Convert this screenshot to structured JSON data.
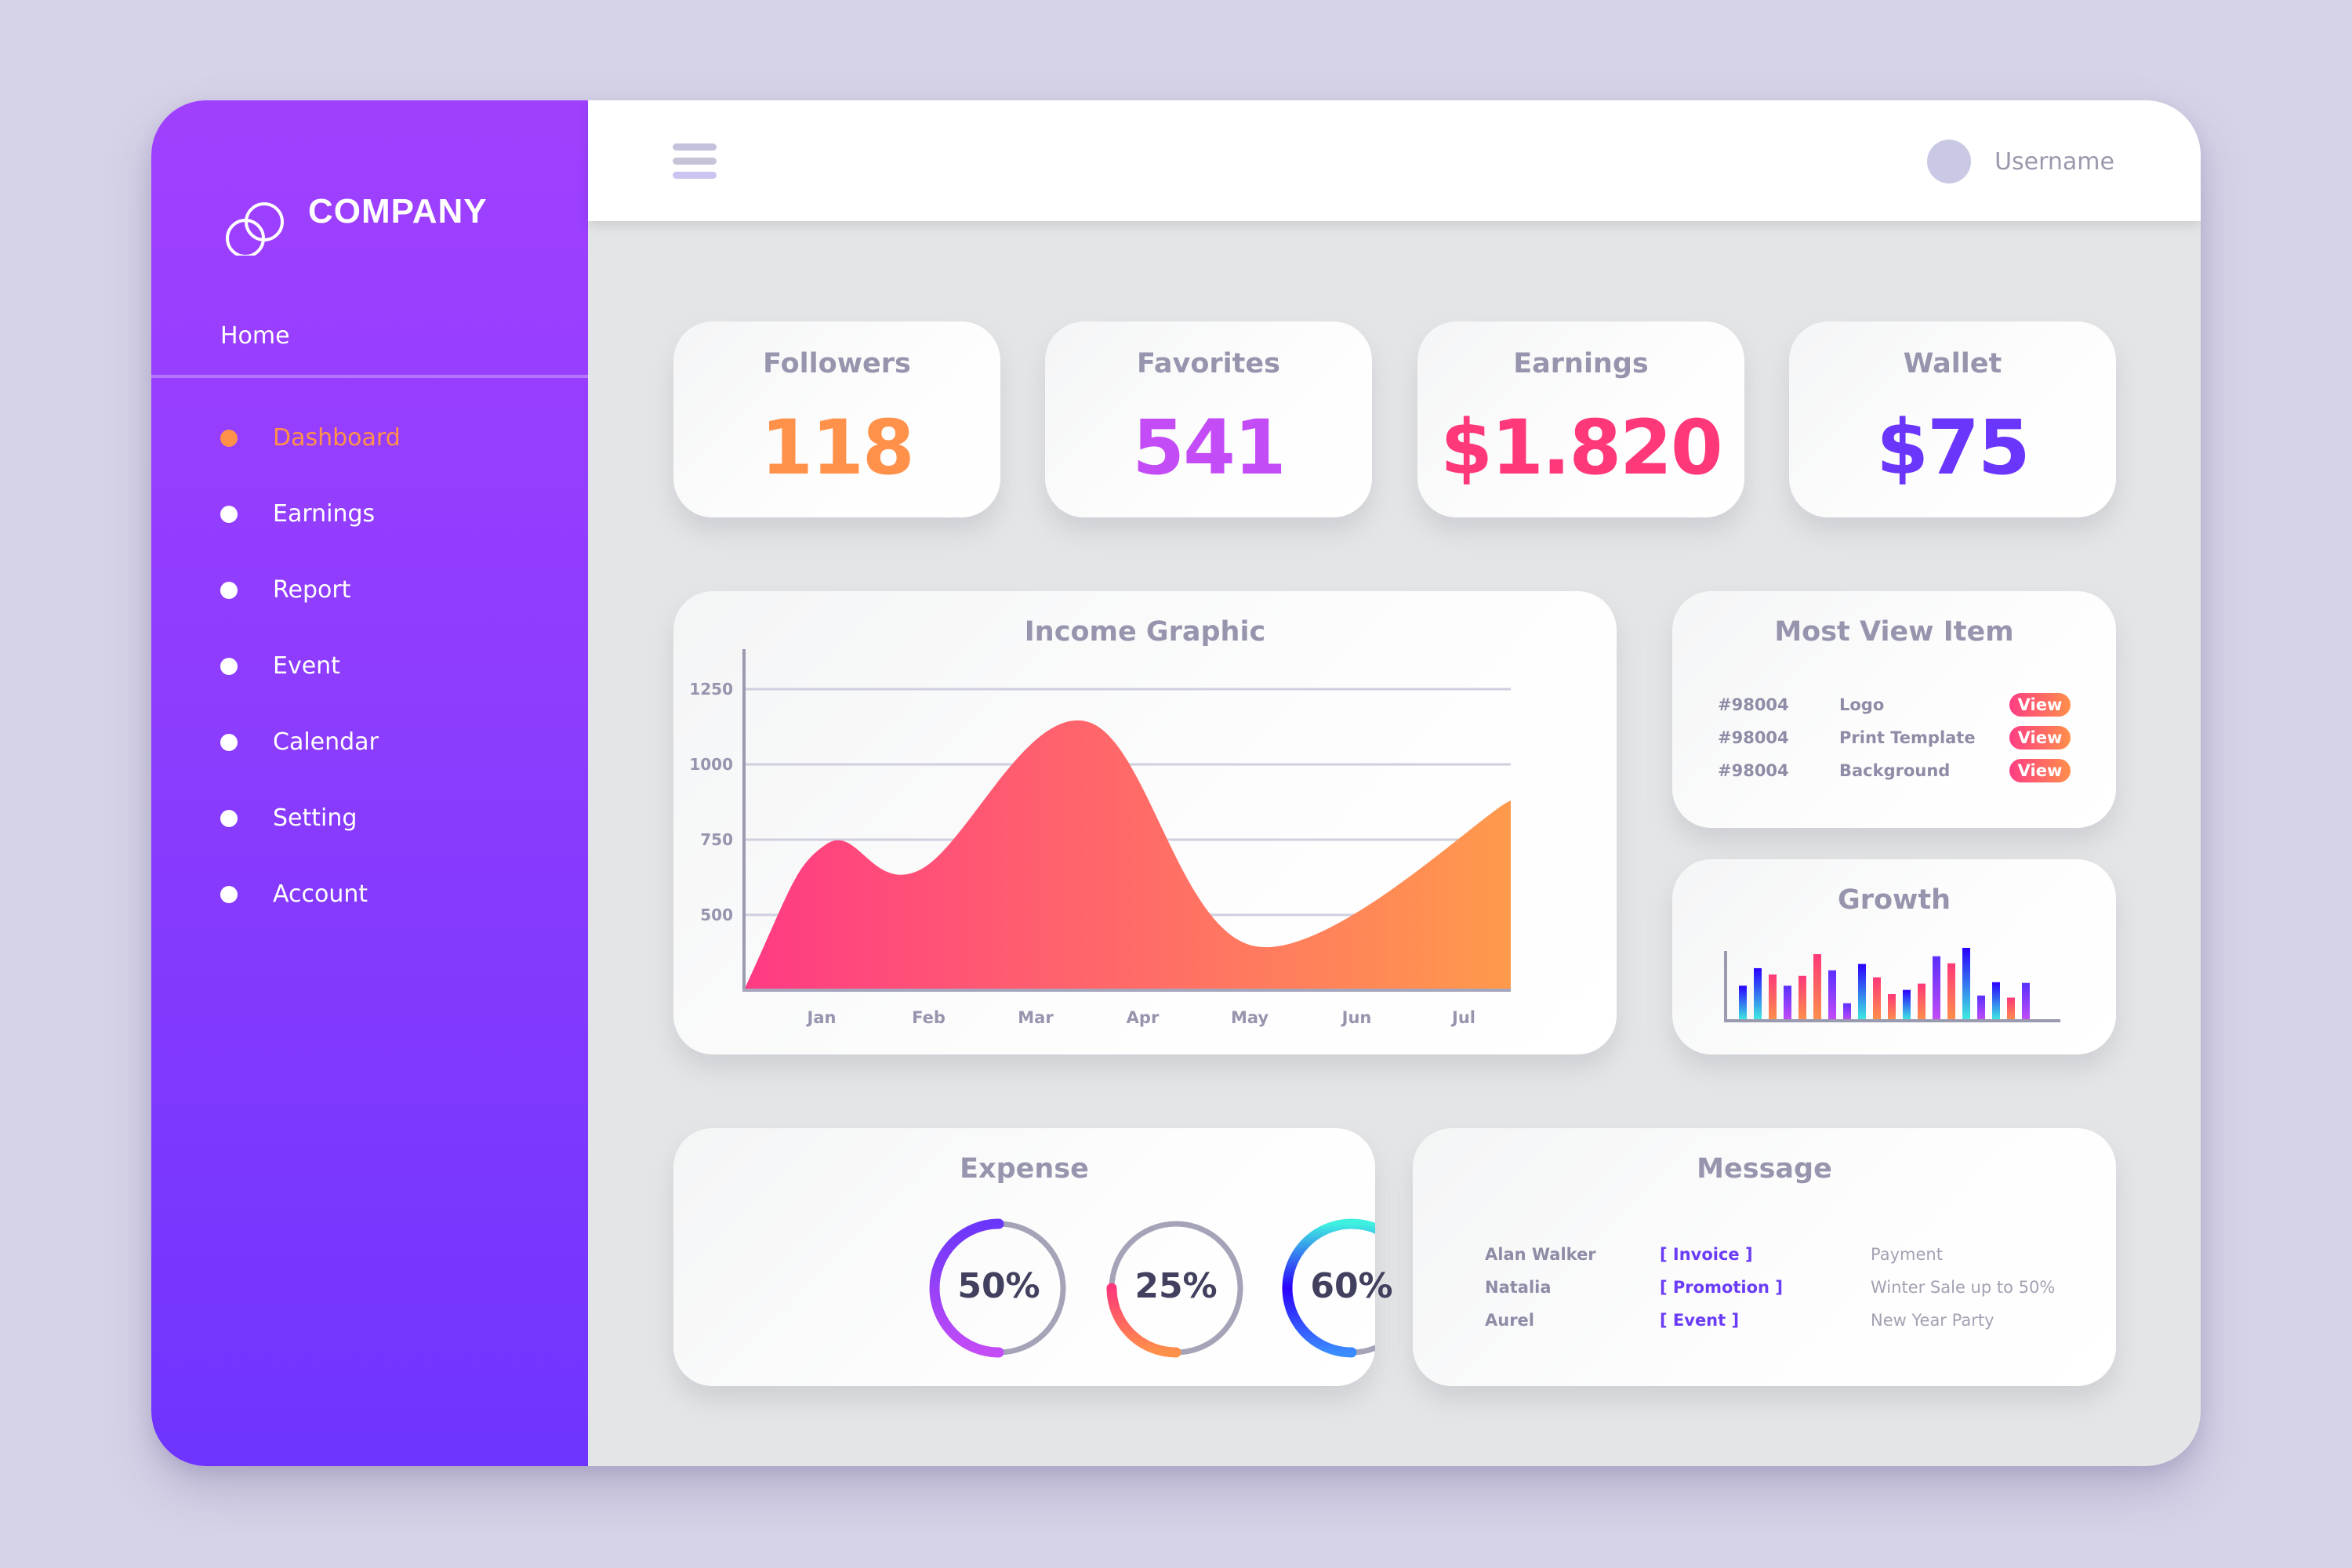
{
  "brand": {
    "name": "COMPANY",
    "logo_icon": "interlocking-rings-icon"
  },
  "sidebar": {
    "home_label": "Home",
    "items": [
      {
        "label": "Dashboard",
        "active": true
      },
      {
        "label": "Earnings",
        "active": false
      },
      {
        "label": "Report",
        "active": false
      },
      {
        "label": "Event",
        "active": false
      },
      {
        "label": "Calendar",
        "active": false
      },
      {
        "label": "Setting",
        "active": false
      },
      {
        "label": "Account",
        "active": false
      }
    ],
    "active_color": "#ff9148"
  },
  "topbar": {
    "menu_icon": "hamburger-menu-icon",
    "username": "Username"
  },
  "stats": [
    {
      "title": "Followers",
      "value": "118",
      "color": "#ff914a"
    },
    {
      "title": "Favorites",
      "value": "541",
      "color": "#c44cf6"
    },
    {
      "title": "Earnings",
      "value": "$1.820",
      "color": "#ff3879"
    },
    {
      "title": "Wallet",
      "value": "$75",
      "color": "#6a36fb"
    }
  ],
  "most_view": {
    "title": "Most View Item",
    "rows": [
      {
        "id": "#98004",
        "name": "Logo",
        "action": "View"
      },
      {
        "id": "#98004",
        "name": "Print Template",
        "action": "View"
      },
      {
        "id": "#98004",
        "name": "Background",
        "action": "View"
      }
    ]
  },
  "growth": {
    "title": "Growth"
  },
  "expense": {
    "title": "Expense",
    "rings": [
      {
        "label": "50%",
        "value": 0.5,
        "colors": [
          "#c44cf6",
          "#6a36fb"
        ]
      },
      {
        "label": "25%",
        "value": 0.25,
        "colors": [
          "#ff914a",
          "#ff3879"
        ]
      },
      {
        "label": "60%",
        "value": 0.6,
        "colors": [
          "#3b8cff",
          "#2a00ff",
          "#3ff0e0"
        ]
      }
    ]
  },
  "message": {
    "title": "Message",
    "rows": [
      {
        "name": "Alan Walker",
        "tag": "[ Invoice ]",
        "text": "Payment"
      },
      {
        "name": "Natalia",
        "tag": "[ Promotion ]",
        "text": "Winter Sale up to 50%"
      },
      {
        "name": "Aurel",
        "tag": "[ Event ]",
        "text": "New Year Party"
      }
    ]
  },
  "chart_data": [
    {
      "type": "area",
      "title": "Income Graphic",
      "categories": [
        "Jan",
        "Feb",
        "Mar",
        "Apr",
        "May",
        "Jun",
        "Jul"
      ],
      "yticks": [
        500,
        750,
        1000,
        1250
      ],
      "ylim": [
        250,
        1400
      ],
      "grid": true,
      "points_x_in_months": [
        -0.72,
        0.04,
        0.91,
        2.47,
        4.05,
        5.44
      ],
      "points_y": [
        250,
        734,
        648,
        1143,
        396,
        880
      ],
      "gradient": [
        "#ff3a84",
        "#ff9a4c"
      ],
      "xlabel": "",
      "ylabel": ""
    },
    {
      "type": "bar",
      "title": "Growth",
      "values": [
        50,
        75,
        66,
        50,
        64,
        95,
        72,
        25,
        81,
        62,
        38,
        44,
        53,
        92,
        82,
        104,
        36,
        55,
        33,
        54
      ],
      "bar_styles": [
        "cool",
        "cool",
        "warm",
        "violet",
        "warm",
        "warm",
        "violet",
        "violet",
        "cool",
        "warm",
        "warm",
        "cool",
        "warm",
        "violet",
        "warm",
        "cool",
        "violet",
        "cool",
        "warm",
        "violet"
      ],
      "style_colors": {
        "cool": [
          "#2a00ff",
          "#3ff0e0"
        ],
        "warm": [
          "#ff3879",
          "#ff914a"
        ],
        "violet": [
          "#5a30ff",
          "#c44cf6"
        ]
      },
      "ylim": [
        0,
        104
      ],
      "grid": false
    }
  ]
}
